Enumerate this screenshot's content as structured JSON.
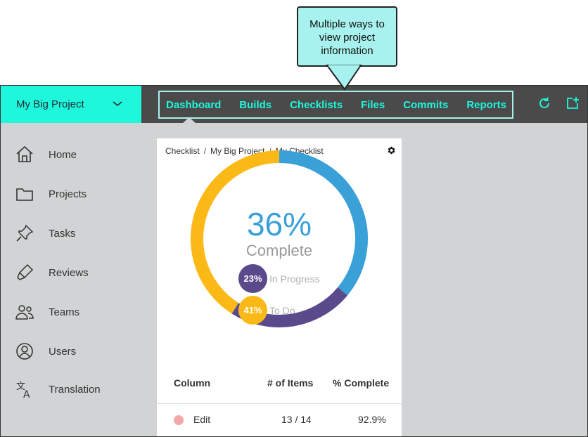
{
  "callout": {
    "lines": [
      "Multiple ways to",
      "view project",
      "information"
    ]
  },
  "project": {
    "name": "My Big Project"
  },
  "nav": {
    "tabs": [
      "Dashboard",
      "Builds",
      "Checklists",
      "Files",
      "Commits",
      "Reports"
    ],
    "active": "Dashboard"
  },
  "sidebar": {
    "items": [
      {
        "label": "Home",
        "icon": "home-icon"
      },
      {
        "label": "Projects",
        "icon": "folder-icon"
      },
      {
        "label": "Tasks",
        "icon": "pin-icon"
      },
      {
        "label": "Reviews",
        "icon": "highlighter-icon"
      },
      {
        "label": "Teams",
        "icon": "people-icon"
      },
      {
        "label": "Users",
        "icon": "user-circle-icon"
      },
      {
        "label": "Translation",
        "icon": "translate-icon"
      }
    ]
  },
  "card": {
    "breadcrumb": [
      "Checklist",
      "My Big Project",
      "My Checklist"
    ],
    "summary": {
      "percent": "36%",
      "label": "Complete",
      "in_progress_pct": "23%",
      "in_progress_label": "In Progress",
      "todo_pct": "41%",
      "todo_label": "To Do"
    },
    "table": {
      "headers": [
        "Column",
        "# of Items",
        "% Complete"
      ],
      "rows": [
        {
          "name": "Edit",
          "items": "13 / 14",
          "complete": "92.9%",
          "color": "#f4a7a8"
        }
      ]
    }
  },
  "colors": {
    "accent": "#1ff7dc",
    "topbar": "#4a4a4a",
    "complete": "#3aa0d8",
    "in_progress": "#5b4a8b",
    "todo": "#fbb917"
  },
  "donut_fractions": {
    "complete": 0.36,
    "in_progress": 0.23,
    "todo": 0.41
  }
}
